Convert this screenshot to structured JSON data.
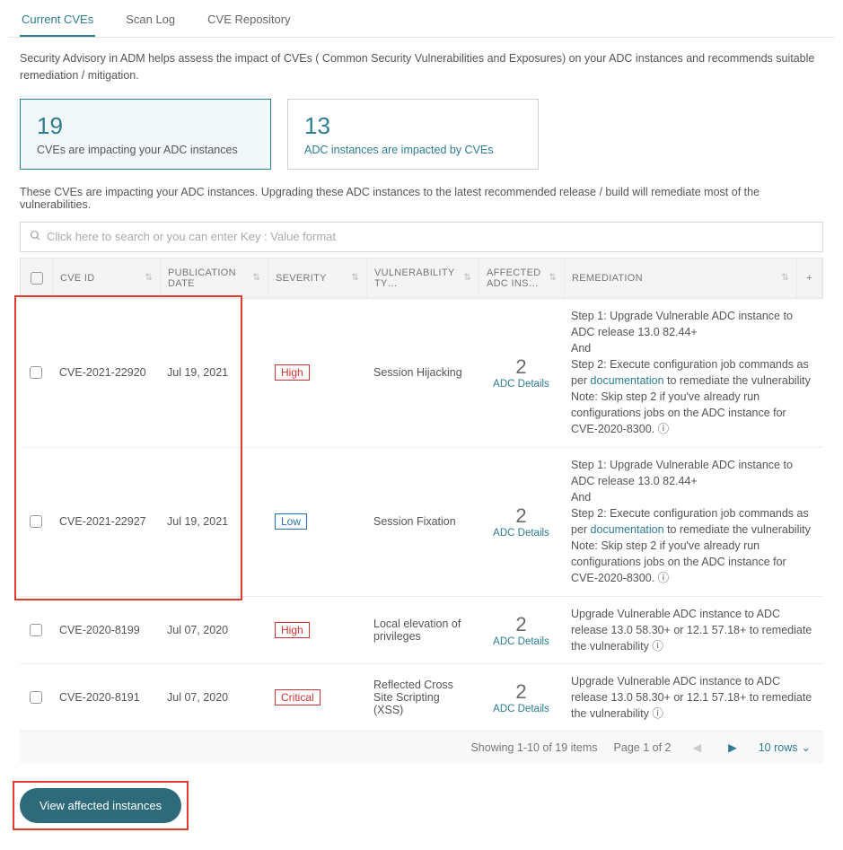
{
  "tabs": {
    "current": "Current CVEs",
    "scanlog": "Scan Log",
    "repo": "CVE Repository"
  },
  "intro": "Security Advisory in ADM helps assess the impact of CVEs ( Common Security Vulnerabilities and Exposures) on your ADC instances and recommends suitable remediation / mitigation.",
  "card1": {
    "num": "19",
    "cap": "CVEs are impacting your ADC instances"
  },
  "card2": {
    "num": "13",
    "cap": "ADC instances are impacted by CVEs"
  },
  "tabledesc": "These CVEs are impacting your ADC instances. Upgrading these ADC instances to the latest recommended release / build will remediate most of the vulnerabilities.",
  "search_placeholder": "Click here to search or you can enter Key : Value format",
  "headers": {
    "id": "CVE ID",
    "pub": "PUBLICATION DATE",
    "sev": "SEVERITY",
    "vul": "VULNERABILITY TY…",
    "aff": "AFFECTED ADC INS…",
    "rem": "REMEDIATION"
  },
  "rows": [
    {
      "id": "CVE-2021-22920",
      "pub": "Jul 19, 2021",
      "sev": "High",
      "sev_class": "",
      "vul": "Session Hijacking",
      "aff_num": "2",
      "aff_link": "ADC Details",
      "rem_pre": "Step 1: Upgrade Vulnerable ADC instance to ADC release 13.0 82.44+\nAnd\nStep 2: Execute configuration job commands as per ",
      "rem_link": "documentation",
      "rem_post": " to remediate the vulnerability\nNote: Skip step 2 if you've already run configurations jobs on the ADC instance for CVE-2020-8300. ⓘ"
    },
    {
      "id": "CVE-2021-22927",
      "pub": "Jul 19, 2021",
      "sev": "Low",
      "sev_class": "sev-low",
      "vul": "Session Fixation",
      "aff_num": "2",
      "aff_link": "ADC Details",
      "rem_pre": "Step 1: Upgrade Vulnerable ADC instance to ADC release 13.0 82.44+\nAnd\nStep 2: Execute configuration job commands as per ",
      "rem_link": "documentation",
      "rem_post": " to remediate the vulnerability\nNote: Skip step 2 if you've already run configurations jobs on the ADC instance for CVE-2020-8300. ⓘ"
    },
    {
      "id": "CVE-2020-8199",
      "pub": "Jul 07, 2020",
      "sev": "High",
      "sev_class": "",
      "vul": "Local elevation of privileges",
      "aff_num": "2",
      "aff_link": "ADC Details",
      "rem_pre": "Upgrade Vulnerable ADC instance to ADC release 13.0 58.30+ or 12.1 57.18+ to remediate the vulnerability ⓘ",
      "rem_link": "",
      "rem_post": ""
    },
    {
      "id": "CVE-2020-8191",
      "pub": "Jul 07, 2020",
      "sev": "Critical",
      "sev_class": "",
      "vul": "Reflected Cross Site Scripting (XSS)",
      "aff_num": "2",
      "aff_link": "ADC Details",
      "rem_pre": "Upgrade Vulnerable ADC instance to ADC release 13.0 58.30+ or 12.1 57.18+ to remediate the vulnerability ⓘ",
      "rem_link": "",
      "rem_post": ""
    }
  ],
  "pager": {
    "showing": "Showing 1-10 of 19 items",
    "page": "Page 1 of 2",
    "rows": "10 rows"
  },
  "view_button": "View affected instances"
}
